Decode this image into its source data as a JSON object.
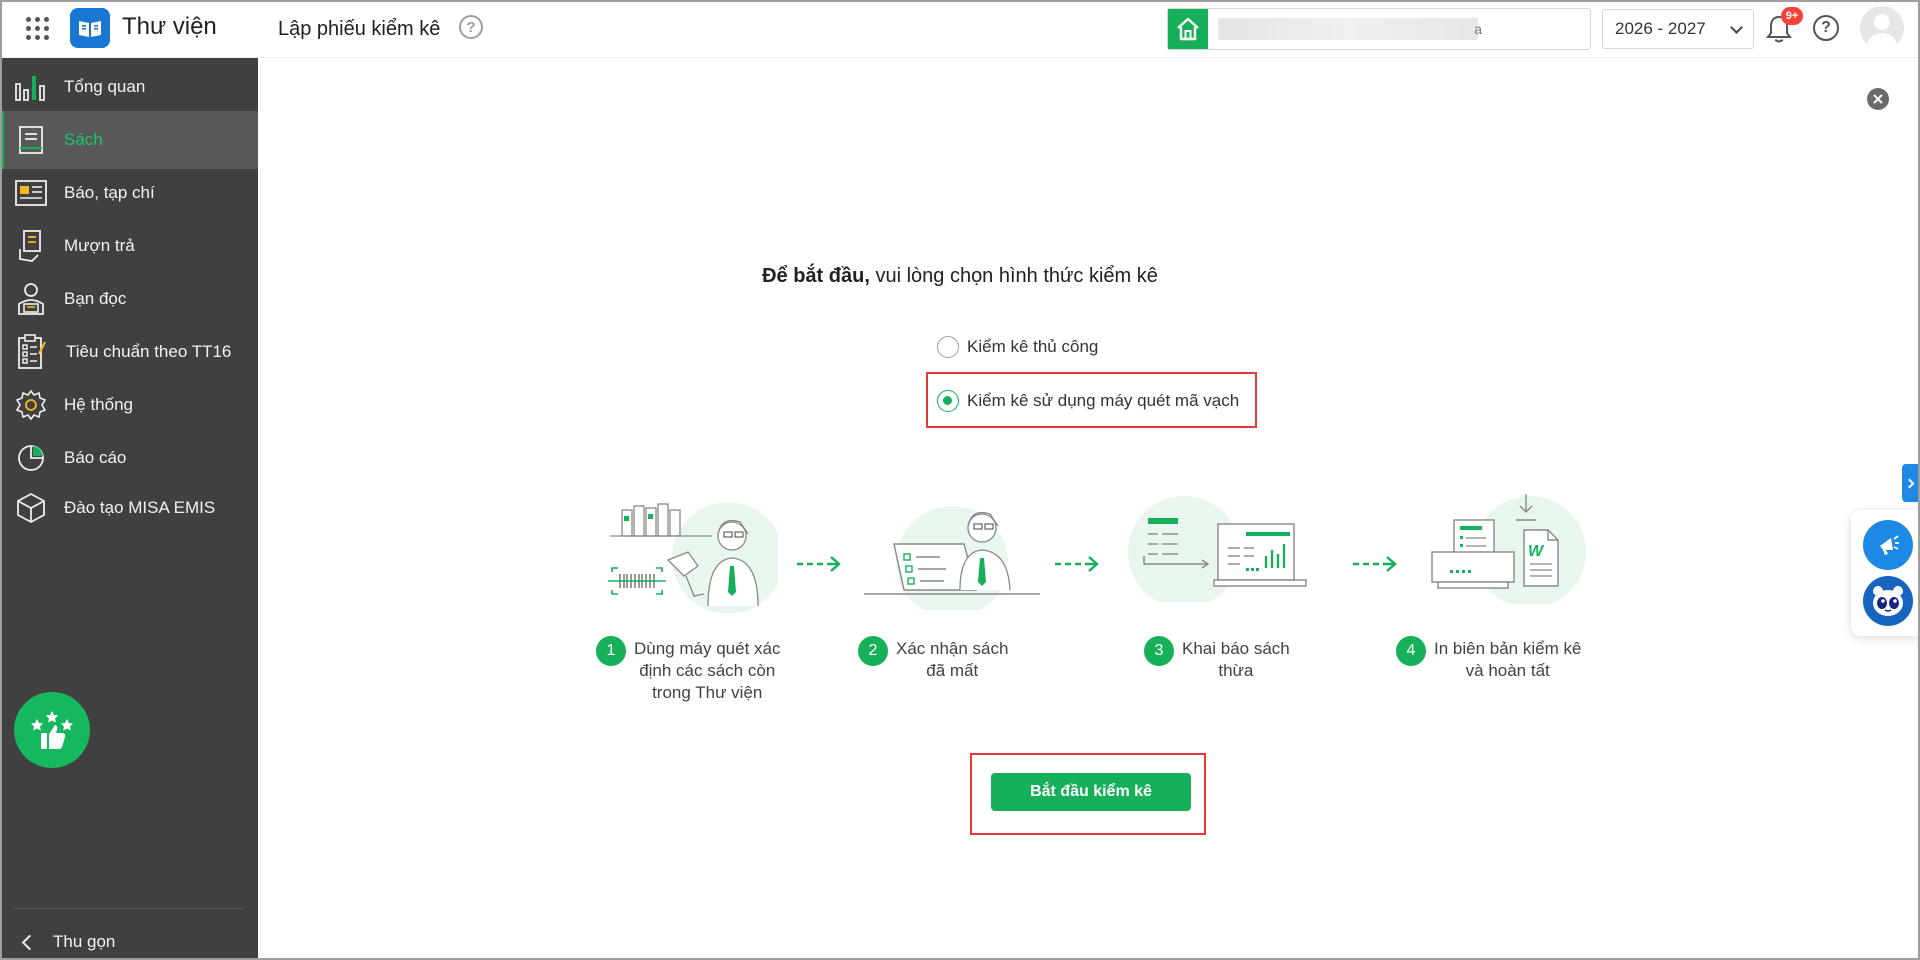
{
  "header": {
    "app_title": "Thư viện",
    "page_title": "Lập phiếu kiểm kê",
    "help_glyph": "?",
    "school_suffix": "a",
    "school_year": "2026 - 2027",
    "notification_badge": "9+"
  },
  "sidebar": {
    "items": [
      {
        "label": "Tổng quan",
        "icon": "chart-bars-icon",
        "active": false
      },
      {
        "label": "Sách",
        "icon": "book-icon",
        "active": true
      },
      {
        "label": "Báo, tạp chí",
        "icon": "newspaper-icon",
        "active": false
      },
      {
        "label": "Mượn trả",
        "icon": "borrow-return-icon",
        "active": false
      },
      {
        "label": "Bạn đọc",
        "icon": "reader-icon",
        "active": false
      },
      {
        "label": "Tiêu chuẩn theo TT16",
        "icon": "clipboard-checklist-icon",
        "active": false
      },
      {
        "label": "Hệ thống",
        "icon": "gear-icon",
        "active": false
      },
      {
        "label": "Báo cáo",
        "icon": "pie-chart-icon",
        "active": false
      },
      {
        "label": "Đào tạo MISA EMIS",
        "icon": "cube-icon",
        "active": false
      }
    ],
    "collapse_label": "Thu gọn"
  },
  "main": {
    "prompt_bold": "Để bắt đầu,",
    "prompt_rest": " vui lòng chọn hình thức kiểm kê",
    "options": [
      {
        "label": "Kiểm kê thủ công",
        "checked": false
      },
      {
        "label": "Kiểm kê sử dụng máy quét mã vạch",
        "checked": true
      }
    ],
    "steps": [
      {
        "num": "1",
        "lines": [
          "Dùng máy quét xác",
          "định các sách còn",
          "trong Thư viện"
        ]
      },
      {
        "num": "2",
        "lines": [
          "Xác nhận sách",
          "đã mất"
        ]
      },
      {
        "num": "3",
        "lines": [
          "Khai báo sách",
          "thừa"
        ]
      },
      {
        "num": "4",
        "lines": [
          "In biên bản kiểm kê",
          "và hoàn tất"
        ]
      }
    ],
    "start_button": "Bắt đầu kiểm kê"
  },
  "colors": {
    "accent": "#16b05a",
    "sidebar_bg": "#404040",
    "highlight": "#e53935",
    "blue": "#1e88e5"
  }
}
